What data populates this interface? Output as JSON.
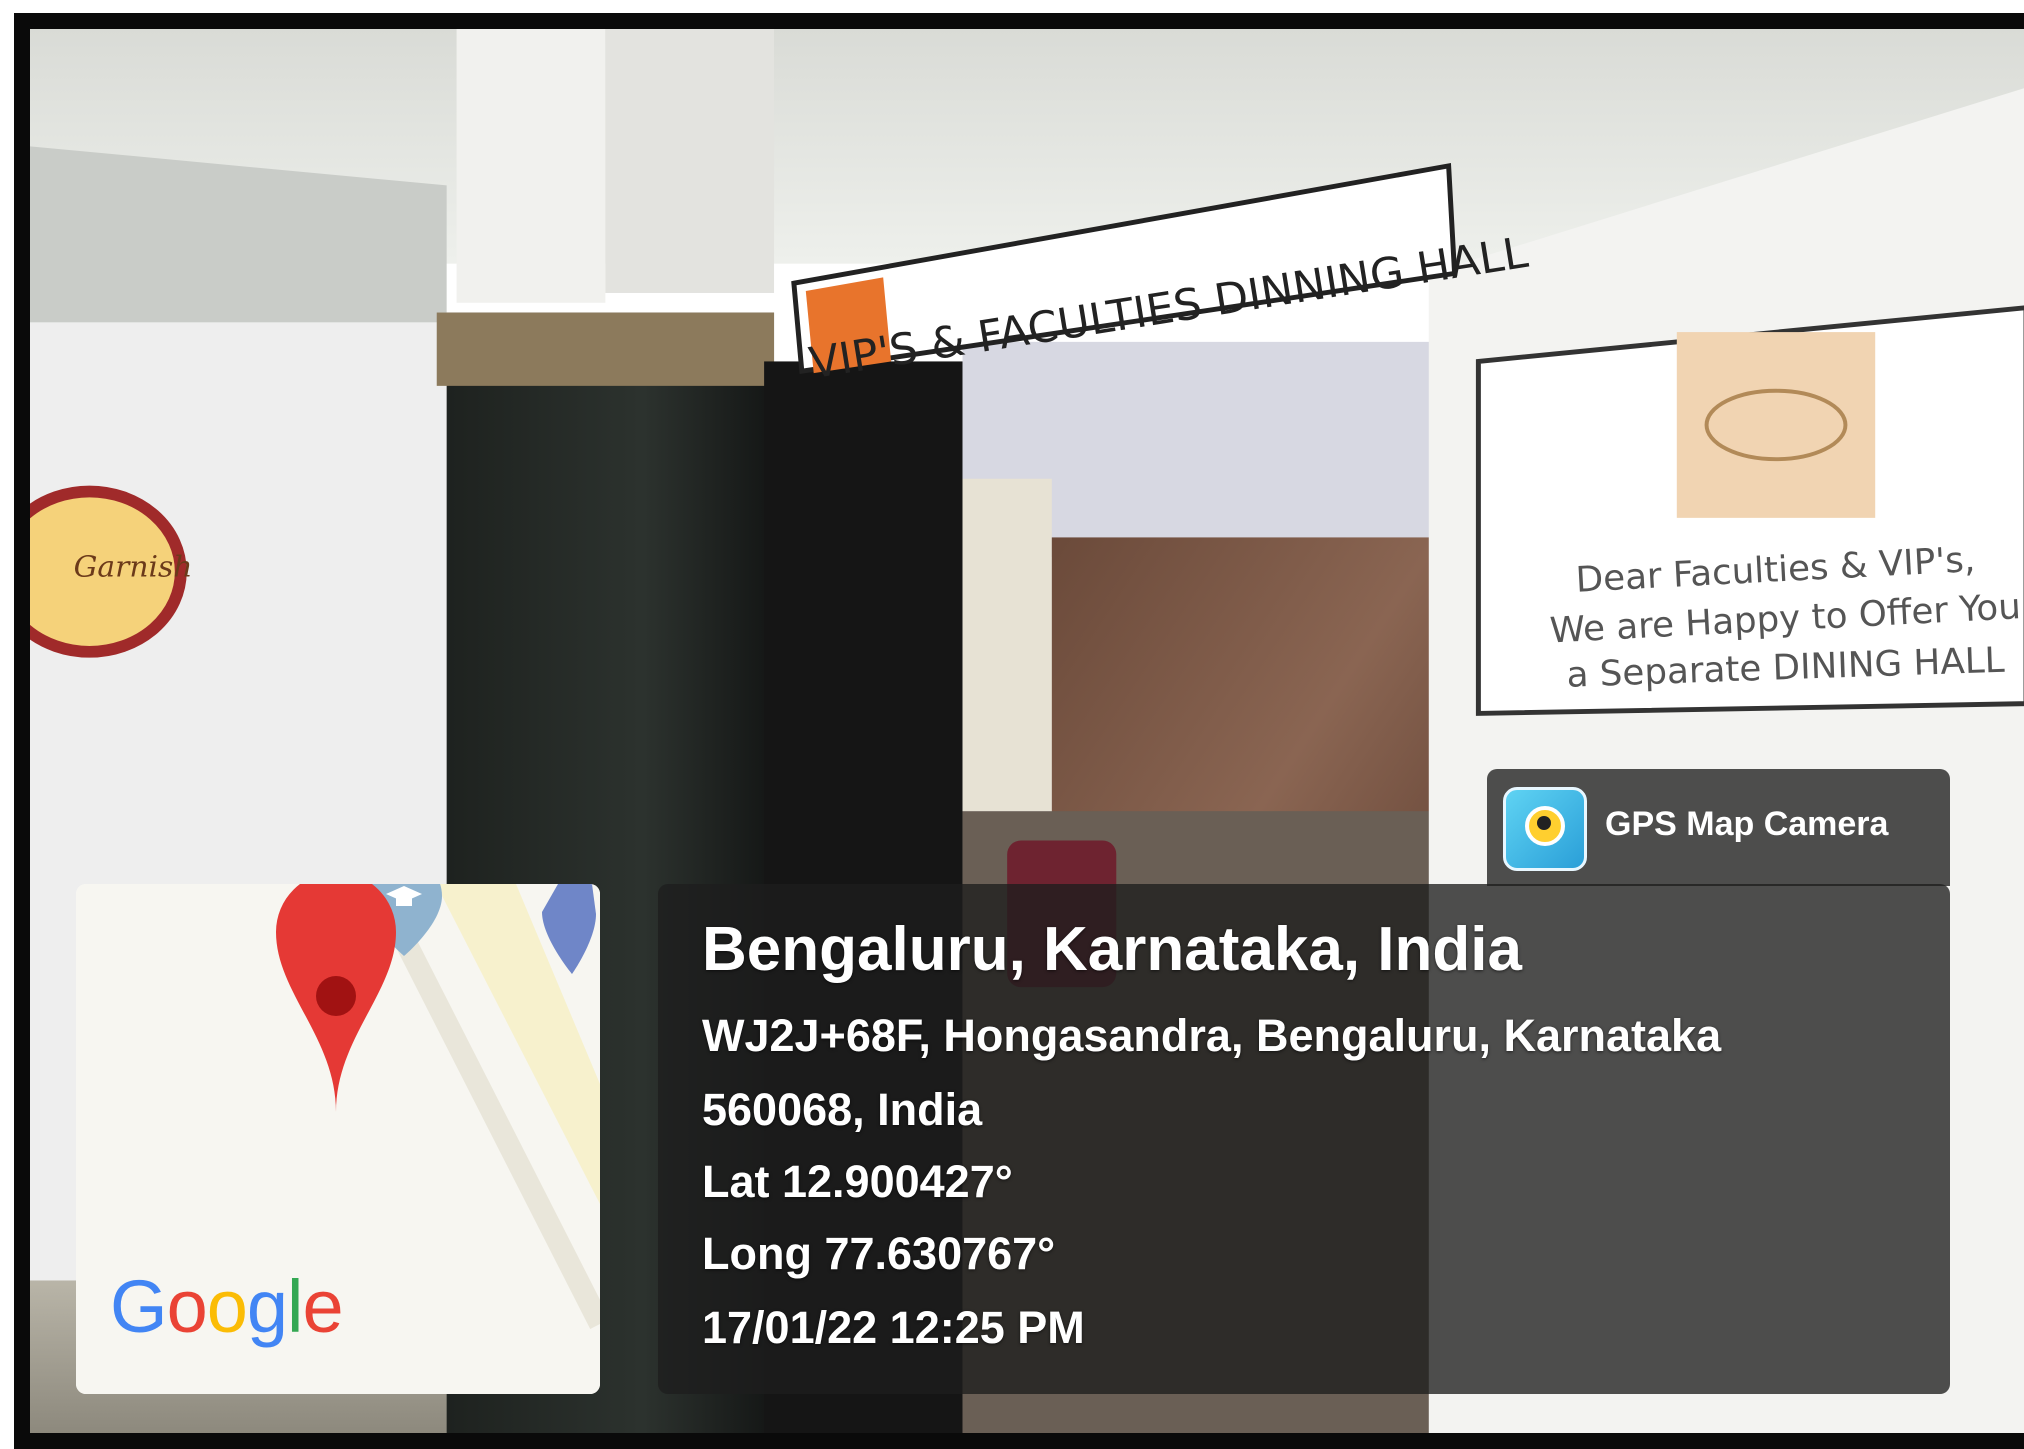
{
  "photo": {
    "door_sign": "VIP'S & FACULTIES DINNING HALL",
    "notice_board": {
      "lines": [
        "Dear Faculties & VIP's,",
        "We are Happy to Offer You",
        "a Separate DINING HALL"
      ]
    },
    "wall_logo_text": "Garnish"
  },
  "gps_overlay": {
    "app_name": "GPS Map Camera",
    "app_icon": "gps-map-camera-icon",
    "city": "Bengaluru, Karnataka, India",
    "address_line_1": "WJ2J+68F, Hongasandra, Bengaluru, Karnataka",
    "address_line_2": "560068, India",
    "latitude": "Lat 12.900427°",
    "longitude": "Long 77.630767°",
    "timestamp": "17/01/22 12:25 PM"
  },
  "map_thumbnail": {
    "attribution": "Google",
    "attribution_colors": [
      "#4285F4",
      "#EA4335",
      "#FBBC05",
      "#4285F4",
      "#34A853",
      "#EA4335"
    ],
    "pin_color": "#E53935",
    "icons": [
      "location-pin-icon",
      "education-pin-icon",
      "place-pin-icon"
    ]
  }
}
